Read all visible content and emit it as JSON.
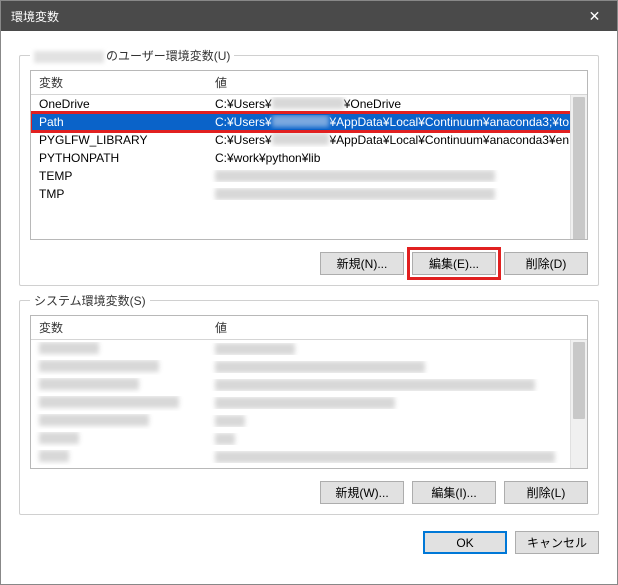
{
  "window": {
    "title": "環境変数",
    "close_glyph": "✕"
  },
  "user_section": {
    "label_suffix": "のユーザー環境変数(U)",
    "headers": {
      "variable": "変数",
      "value": "値"
    },
    "rows": [
      {
        "var": "OneDrive",
        "val_prefix": "C:¥Users¥",
        "val_suffix": "¥OneDrive"
      },
      {
        "var": "Path",
        "val_prefix": "C:¥Users¥",
        "val_suffix": "¥AppData¥Local¥Continuum¥anaconda3;¥to..."
      },
      {
        "var": "PYGLFW_LIBRARY",
        "val_prefix": "C:¥Users¥",
        "val_suffix": "¥AppData¥Local¥Continuum¥anaconda3¥en..."
      },
      {
        "var": "PYTHONPATH",
        "val_prefix": "C:¥work¥python¥lib",
        "val_suffix": ""
      },
      {
        "var": "TEMP",
        "val_prefix": "",
        "val_suffix": ""
      },
      {
        "var": "TMP",
        "val_prefix": "",
        "val_suffix": ""
      }
    ],
    "buttons": {
      "new": "新規(N)...",
      "edit": "編集(E)...",
      "delete": "削除(D)"
    }
  },
  "system_section": {
    "label": "システム環境変数(S)",
    "headers": {
      "variable": "変数",
      "value": "値"
    },
    "buttons": {
      "new": "新規(W)...",
      "edit": "編集(I)...",
      "delete": "削除(L)"
    }
  },
  "footer": {
    "ok": "OK",
    "cancel": "キャンセル"
  }
}
